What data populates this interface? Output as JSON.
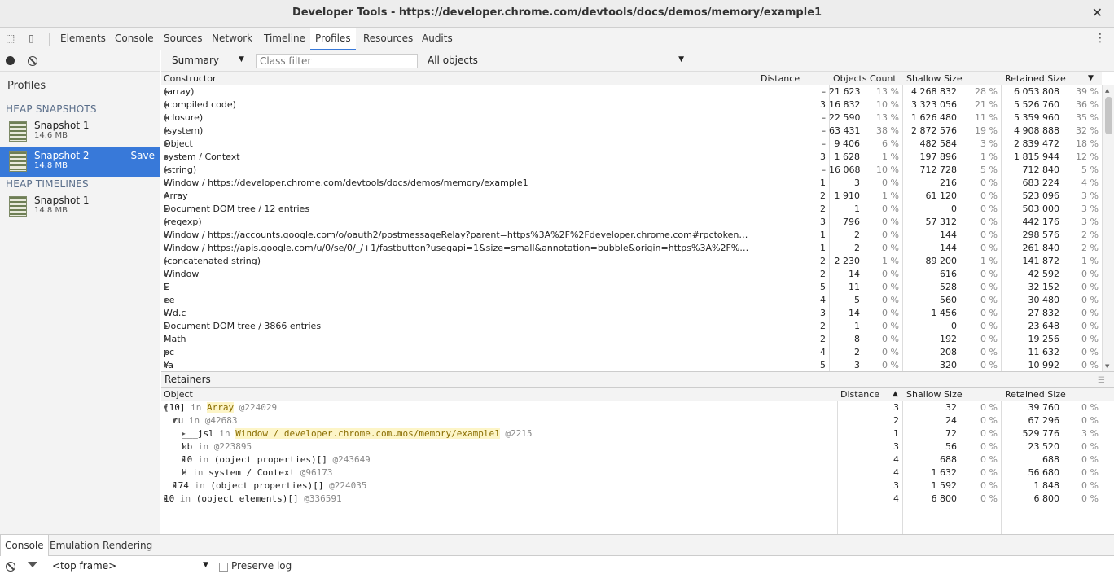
{
  "title": "Developer Tools - https://developer.chrome.com/devtools/docs/demos/memory/example1",
  "tabs": [
    "Elements",
    "Console",
    "Sources",
    "Network",
    "Timeline",
    "Profiles",
    "Resources",
    "Audits"
  ],
  "active_tab": "Profiles",
  "sidebar": {
    "heading": "Profiles",
    "heap_snapshots_label": "HEAP SNAPSHOTS",
    "heap_timelines_label": "HEAP TIMELINES",
    "snapshots": [
      {
        "name": "Snapshot 1",
        "size": "14.6 MB"
      },
      {
        "name": "Snapshot 2",
        "size": "14.8 MB",
        "save": "Save"
      }
    ],
    "timelines": [
      {
        "name": "Snapshot 1",
        "size": "14.8 MB"
      }
    ]
  },
  "toolbar": {
    "view": "Summary",
    "class_filter_placeholder": "Class filter",
    "objects": "All objects"
  },
  "summary_headers": {
    "constructor": "Constructor",
    "distance": "Distance",
    "count": "Objects Count",
    "shallow": "Shallow Size",
    "retained": "Retained Size"
  },
  "summary_rows": [
    [
      "(array)",
      "–",
      "21 623",
      "13 %",
      "4 268 832",
      "28 %",
      "6 053 808",
      "39 %"
    ],
    [
      "(compiled code)",
      "3",
      "16 832",
      "10 %",
      "3 323 056",
      "21 %",
      "5 526 760",
      "36 %"
    ],
    [
      "(closure)",
      "–",
      "22 590",
      "13 %",
      "1 626 480",
      "11 %",
      "5 359 960",
      "35 %"
    ],
    [
      "(system)",
      "–",
      "63 431",
      "38 %",
      "2 872 576",
      "19 %",
      "4 908 888",
      "32 %"
    ],
    [
      "Object",
      "–",
      "9 406",
      "6 %",
      "482 584",
      "3 %",
      "2 839 472",
      "18 %"
    ],
    [
      "system / Context",
      "3",
      "1 628",
      "1 %",
      "197 896",
      "1 %",
      "1 815 944",
      "12 %"
    ],
    [
      "(string)",
      "–",
      "16 068",
      "10 %",
      "712 728",
      "5 %",
      "712 840",
      "5 %"
    ],
    [
      "Window / https://developer.chrome.com/devtools/docs/demos/memory/example1",
      "1",
      "3",
      "0 %",
      "216",
      "0 %",
      "683 224",
      "4 %"
    ],
    [
      "Array",
      "2",
      "1 910",
      "1 %",
      "61 120",
      "0 %",
      "523 096",
      "3 %"
    ],
    [
      "Document DOM tree / 12 entries",
      "2",
      "1",
      "0 %",
      "0",
      "0 %",
      "503 000",
      "3 %"
    ],
    [
      "(regexp)",
      "3",
      "796",
      "0 %",
      "57 312",
      "0 %",
      "442 176",
      "3 %"
    ],
    [
      "Window / https://accounts.google.com/o/oauth2/postmessageRelay?parent=https%3A%2F%2Fdeveloper.chrome.com#rpctoken=79065391…",
      "1",
      "2",
      "0 %",
      "144",
      "0 %",
      "298 576",
      "2 %"
    ],
    [
      "Window / https://apis.google.com/u/0/se/0/_/+1/fastbutton?usegapi=1&size=small&annotation=bubble&origin=https%3A%2F%2Fdevelope…",
      "1",
      "2",
      "0 %",
      "144",
      "0 %",
      "261 840",
      "2 %"
    ],
    [
      "(concatenated string)",
      "2",
      "2 230",
      "1 %",
      "89 200",
      "1 %",
      "141 872",
      "1 %"
    ],
    [
      "Window",
      "2",
      "14",
      "0 %",
      "616",
      "0 %",
      "42 592",
      "0 %"
    ],
    [
      "E",
      "5",
      "11",
      "0 %",
      "528",
      "0 %",
      "32 152",
      "0 %"
    ],
    [
      "ee",
      "4",
      "5",
      "0 %",
      "560",
      "0 %",
      "30 480",
      "0 %"
    ],
    [
      "Wd.c",
      "3",
      "14",
      "0 %",
      "1 456",
      "0 %",
      "27 832",
      "0 %"
    ],
    [
      "Document DOM tree / 3866 entries",
      "2",
      "1",
      "0 %",
      "0",
      "0 %",
      "23 648",
      "0 %"
    ],
    [
      "Math",
      "2",
      "8",
      "0 %",
      "192",
      "0 %",
      "19 256",
      "0 %"
    ],
    [
      "pc",
      "4",
      "2",
      "0 %",
      "208",
      "0 %",
      "11 632",
      "0 %"
    ],
    [
      "Ya",
      "5",
      "3",
      "0 %",
      "320",
      "0 %",
      "10 992",
      "0 %"
    ]
  ],
  "retainers_label": "Retainers",
  "retainer_headers": {
    "object": "Object",
    "distance": "Distance",
    "shallow": "Shallow Size",
    "retained": "Retained Size"
  },
  "retainer_rows": [
    {
      "indent": 0,
      "open": true,
      "a": "[10]",
      "b": " in ",
      "c": "Array",
      "d": " @224029",
      "hl": true,
      "dist": "3",
      "sh": "32",
      "shp": "0 %",
      "rt": "39 760",
      "rtp": "0 %"
    },
    {
      "indent": 1,
      "open": true,
      "a": "cu",
      "b": " in ",
      "c": "",
      "d": "@42683",
      "hl": false,
      "dist": "2",
      "sh": "24",
      "shp": "0 %",
      "rt": "67 296",
      "rtp": "0 %"
    },
    {
      "indent": 2,
      "open": false,
      "a": "___jsl",
      "b": " in ",
      "c": "Window / developer.chrome.com…mos/memory/example1",
      "d": " @2215",
      "hl": true,
      "dist": "1",
      "sh": "72",
      "shp": "0 %",
      "rt": "529 776",
      "rtp": "3 %"
    },
    {
      "indent": 2,
      "open": false,
      "a": "bb",
      "b": " in ",
      "c": "",
      "d": "@223895",
      "hl": false,
      "dist": "3",
      "sh": "56",
      "shp": "0 %",
      "rt": "23 520",
      "rtp": "0 %"
    },
    {
      "indent": 2,
      "open": false,
      "a": "10",
      "b": " in ",
      "c": "(object properties)[]",
      "d": " @243649",
      "hl": false,
      "dist": "4",
      "sh": "688",
      "shp": "0 %",
      "rt": "688",
      "rtp": "0 %"
    },
    {
      "indent": 2,
      "open": false,
      "a": "H",
      "b": " in ",
      "c": "system / Context",
      "d": " @96173",
      "hl": false,
      "dist": "4",
      "sh": "1 632",
      "shp": "0 %",
      "rt": "56 680",
      "rtp": "0 %"
    },
    {
      "indent": 1,
      "open": false,
      "a": "174",
      "b": " in ",
      "c": "(object properties)[]",
      "d": " @224035",
      "hl": false,
      "dist": "3",
      "sh": "1 592",
      "shp": "0 %",
      "rt": "1 848",
      "rtp": "0 %"
    },
    {
      "indent": 0,
      "open": false,
      "a": "10",
      "b": " in ",
      "c": "(object elements)[]",
      "d": " @336591",
      "hl": false,
      "dist": "4",
      "sh": "6 800",
      "shp": "0 %",
      "rt": "6 800",
      "rtp": "0 %"
    }
  ],
  "drawer_tabs": [
    "Console",
    "Emulation",
    "Rendering"
  ],
  "console": {
    "frame": "<top frame>",
    "preserve_log": "Preserve log"
  }
}
